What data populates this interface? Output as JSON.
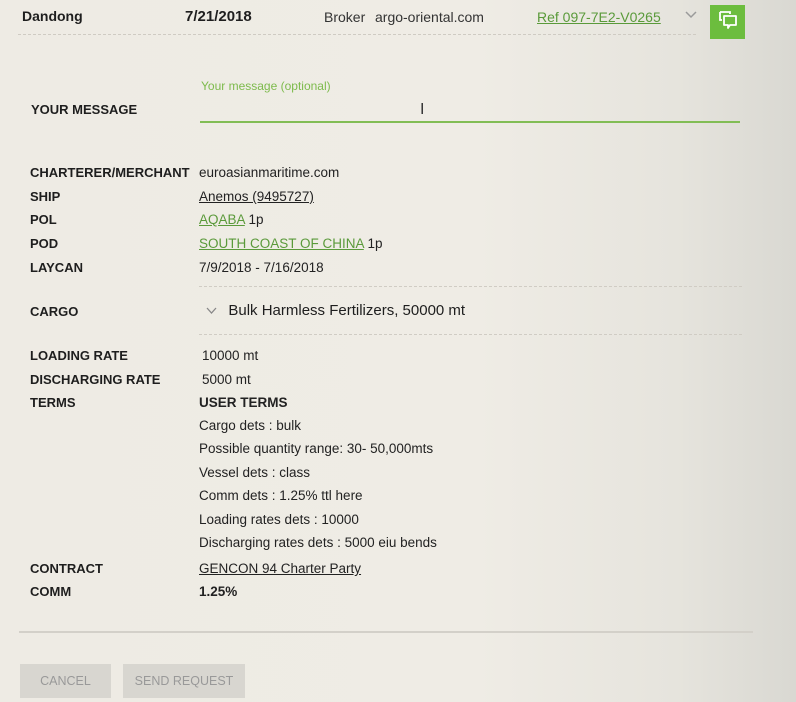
{
  "header": {
    "origin": "Dandong",
    "date": "7/21/2018",
    "broker_label": "Broker",
    "broker_value": "argo-oriental.com",
    "ref": "Ref 097-7E2-V0265",
    "expand_icon": "chevron-down-icon",
    "chat_icon": "chat-bubbles-icon",
    "accent_color": "#6cbd3e"
  },
  "message": {
    "label": "YOUR MESSAGE",
    "placeholder": "Your message (optional)",
    "value": ""
  },
  "details": {
    "charterer": {
      "label": "CHARTERER/MERCHANT",
      "value": "euroasianmaritime.com"
    },
    "ship": {
      "label": "SHIP",
      "value": "Anemos (9495727)"
    },
    "pol": {
      "label": "POL",
      "value": "AQABA",
      "suffix": "1p"
    },
    "pod": {
      "label": "POD",
      "value": "SOUTH COAST OF CHINA",
      "suffix": "1p"
    },
    "laycan": {
      "label": "LAYCAN",
      "value": "7/9/2018 - 7/16/2018"
    },
    "cargo": {
      "label": "CARGO",
      "value": "Bulk Harmless Fertilizers, 50000 mt"
    },
    "loading_rate": {
      "label": "LOADING RATE",
      "value": "10000 mt"
    },
    "discharging_rate": {
      "label": "DISCHARGING RATE",
      "value": "5000 mt"
    },
    "terms": {
      "label": "TERMS",
      "heading": "USER TERMS",
      "lines": [
        "Cargo dets : bulk",
        "Possible quantity range: 30- 50,000mts",
        "Vessel dets : class",
        "Comm dets : 1.25% ttl here",
        "Loading rates dets : 10000",
        "Discharging rates dets : 5000 eiu bends"
      ]
    },
    "contract": {
      "label": "CONTRACT",
      "value": "GENCON 94 Charter Party"
    },
    "comm": {
      "label": "COMM",
      "value": "1.25%"
    }
  },
  "actions": {
    "cancel": "CANCEL",
    "send": "SEND REQUEST"
  }
}
